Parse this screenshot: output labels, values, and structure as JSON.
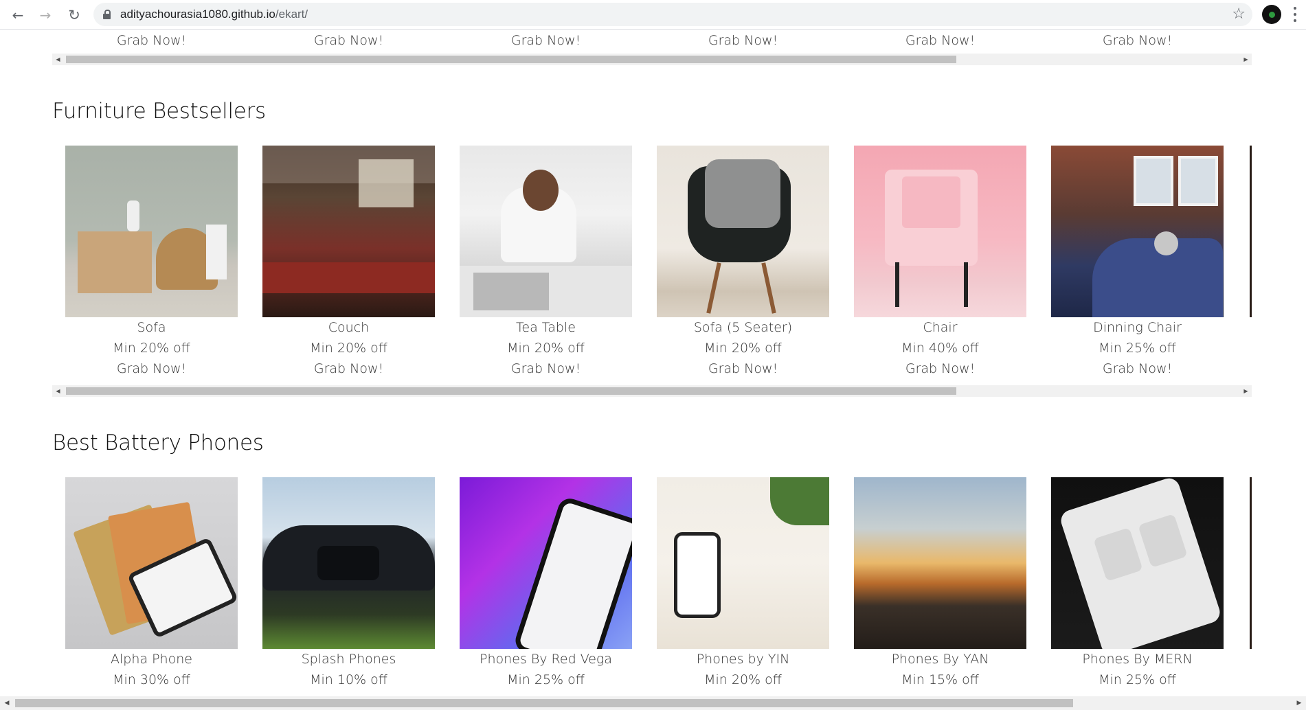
{
  "browser": {
    "url_domain": "adityachourasia1080.github.io",
    "url_path": "/ekart/"
  },
  "top_row": {
    "grab_labels": [
      "Grab Now!",
      "Grab Now!",
      "Grab Now!",
      "Grab Now!",
      "Grab Now!",
      "Grab Now!"
    ]
  },
  "furniture": {
    "title": "Furniture Bestsellers",
    "items": [
      {
        "name": "Sofa",
        "offer": "Min 20% off",
        "cta": "Grab Now!",
        "image": "sofa-room-photo"
      },
      {
        "name": "Couch",
        "offer": "Min 20% off",
        "cta": "Grab Now!",
        "image": "cafe-counter-photo"
      },
      {
        "name": "Tea Table",
        "offer": "Min 20% off",
        "cta": "Grab Now!",
        "image": "man-at-table-photo"
      },
      {
        "name": "Sofa (5 Seater)",
        "offer": "Min 20% off",
        "cta": "Grab Now!",
        "image": "black-chair-photo"
      },
      {
        "name": "Chair",
        "offer": "Min 40% off",
        "cta": "Grab Now!",
        "image": "pink-chair-photo"
      },
      {
        "name": "Dinning Chair",
        "offer": "Min 25% off",
        "cta": "Grab Now!",
        "image": "scooter-photo"
      }
    ]
  },
  "phones": {
    "title": "Best Battery Phones",
    "items": [
      {
        "name": "Alpha Phone",
        "offer": "Min 30% off",
        "image": "phone-on-banknotes-photo"
      },
      {
        "name": "Splash Phones",
        "offer": "Min 10% off",
        "image": "black-car-photo"
      },
      {
        "name": "Phones By Red Vega",
        "offer": "Min 25% off",
        "image": "phone-covid-screen-photo"
      },
      {
        "name": "Phones by YIN",
        "offer": "Min 20% off",
        "image": "white-phone-desk-photo"
      },
      {
        "name": "Phones By YAN",
        "offer": "Min 15% off",
        "image": "sunset-landscape-photo"
      },
      {
        "name": "Phones By MERN",
        "offer": "Min 25% off",
        "image": "phone-app-screen-photo"
      }
    ]
  },
  "icons": {
    "back": "arrow-left-icon",
    "forward": "arrow-right-icon",
    "reload": "reload-icon",
    "lock": "lock-icon",
    "bookmark": "star-icon",
    "profile": "avatar-icon",
    "menu": "kebab-menu-icon"
  },
  "colors": {
    "scrollbar_track": "#f1f1f1",
    "scrollbar_thumb": "#c1c1c1",
    "omnibox_bg": "#f1f3f4"
  }
}
